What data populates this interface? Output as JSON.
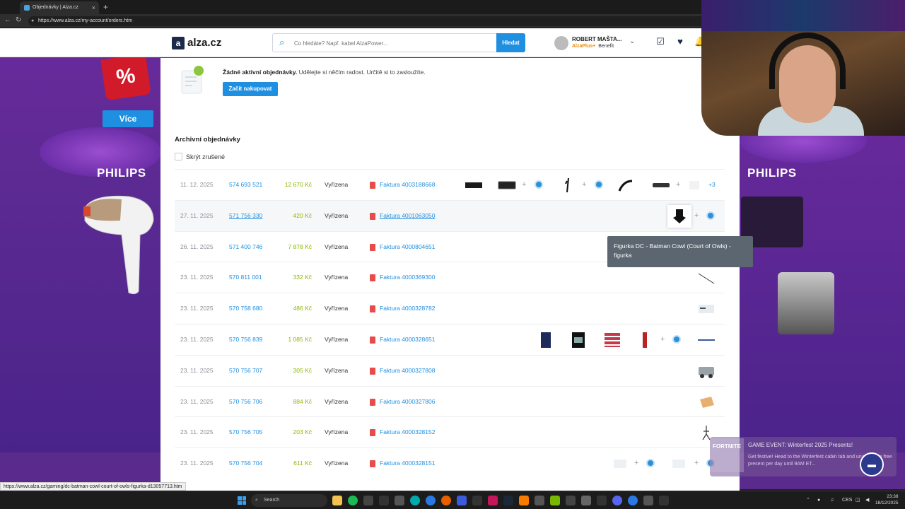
{
  "browser": {
    "tab_title": "Objednávky | Alza.cz",
    "tab_close": "×",
    "new_tab": "+",
    "url": "https://www.alza.cz/my-account/orders.htm"
  },
  "header": {
    "logo": "alza.cz",
    "search_placeholder": "Co hledáte? Např. kabel AlzaPower...",
    "search_button": "Hledat",
    "user_name": "ROBERT MAŠTA...",
    "user_plus": "AlzaPlus+",
    "user_benefit": "Benefit"
  },
  "banners": {
    "left_brand": "PHILIPS",
    "left_button": "Více",
    "promo_symbol": "%",
    "right_brand": "PHILIPS"
  },
  "empty_state": {
    "title": "Žádné aktivní objednávky.",
    "text": "Udělejte si něčím radost. Určitě si to zasloužíte.",
    "button": "Začít nakupovat"
  },
  "archive": {
    "title": "Archivní objednávky",
    "hide_cancelled": "Skrýt zrušené",
    "orders": [
      {
        "date": "11. 12. 2025",
        "number": "574 693 521",
        "price": "12 670 Kč",
        "status": "Vyřízena",
        "invoice": "Faktura 4003188668",
        "more": "+3"
      },
      {
        "date": "27. 11. 2025",
        "number": "571 756 330",
        "price": "420 Kč",
        "status": "Vyřízena",
        "invoice": "Faktura 4001063050"
      },
      {
        "date": "26. 11. 2025",
        "number": "571 400 746",
        "price": "7 878 Kč",
        "status": "Vyřízena",
        "invoice": "Faktura 4000804651"
      },
      {
        "date": "23. 11. 2025",
        "number": "570 811 001",
        "price": "332 Kč",
        "status": "Vyřízena",
        "invoice": "Faktura 4000369300"
      },
      {
        "date": "23. 11. 2025",
        "number": "570 758 680",
        "price": "486 Kč",
        "status": "Vyřízena",
        "invoice": "Faktura 4000328782"
      },
      {
        "date": "23. 11. 2025",
        "number": "570 756 839",
        "price": "1 085 Kč",
        "status": "Vyřízena",
        "invoice": "Faktura 4000328651"
      },
      {
        "date": "23. 11. 2025",
        "number": "570 756 707",
        "price": "305 Kč",
        "status": "Vyřízena",
        "invoice": "Faktura 4000327808"
      },
      {
        "date": "23. 11. 2025",
        "number": "570 756 706",
        "price": "884 Kč",
        "status": "Vyřízena",
        "invoice": "Faktura 4000327806"
      },
      {
        "date": "23. 11. 2025",
        "number": "570 756 705",
        "price": "203 Kč",
        "status": "Vyřízena",
        "invoice": "Faktura 4000328152"
      },
      {
        "date": "23. 11. 2025",
        "number": "570 756 704",
        "price": "611 Kč",
        "status": "Vyřízena",
        "invoice": "Faktura 4000328151"
      }
    ]
  },
  "tooltip": {
    "line1": "Figurka DC - Batman Cowl (Court of Owls) -",
    "line2": "figurka"
  },
  "notification": {
    "icon_label": "FORTNITE",
    "title": "GAME EVENT: Winterfest 2025 Presents!",
    "body": "Get festive! Head to the Winterfest cabin tab and unwrap one free present per day until 9AM ET..."
  },
  "status_url": "https://www.alza.cz/gaming/dc-batman-cowl-court-of-owls-figurka-d13057713.htm",
  "taskbar": {
    "search": "Search",
    "lang": "CES",
    "time": "23:38",
    "date": "18/12/2025"
  },
  "colors": {
    "accent": "#1e8fe1",
    "price": "#8cb800",
    "banner": "#5a2a8c"
  }
}
